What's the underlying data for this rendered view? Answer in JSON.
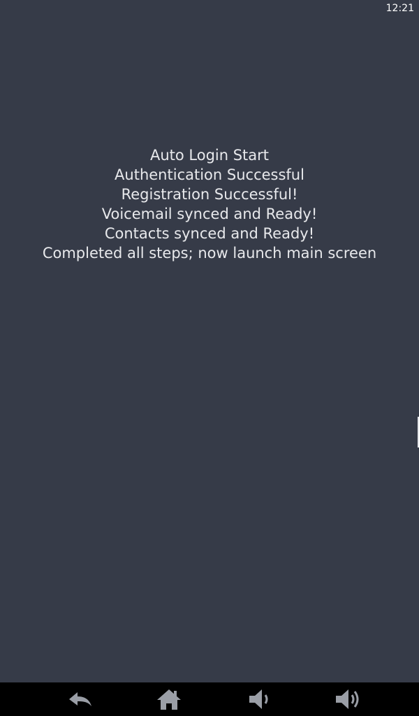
{
  "status_bar": {
    "time": "12:21"
  },
  "messages": [
    "Auto Login Start",
    "Authentication Successful",
    "Registration Successful!",
    "Voicemail synced and Ready!",
    "Contacts synced and Ready!",
    "Completed all steps; now launch main screen"
  ],
  "nav_bar": {
    "buttons": [
      {
        "icon": "back-icon"
      },
      {
        "icon": "home-icon"
      },
      {
        "icon": "volume-down-icon"
      },
      {
        "icon": "volume-up-icon"
      }
    ]
  },
  "colors": {
    "background": "#363b48",
    "text": "#e8e9ec",
    "nav_bar": "#000000",
    "nav_icon": "#9a9ea6"
  }
}
